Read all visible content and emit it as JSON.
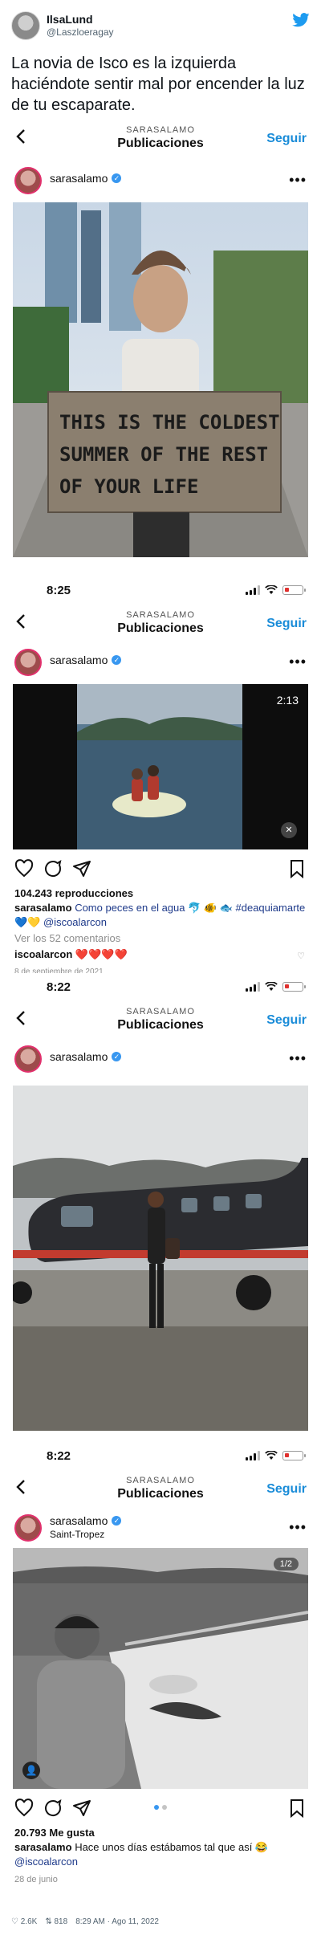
{
  "tweet": {
    "author_name": "IlsaLund",
    "author_handle": "@Laszloeragay",
    "text": "La novia de Isco es la izquierda haciéndote sentir mal por encender la luz de tu escaparate.",
    "likes": "2.6K",
    "retweets": "818",
    "timestamp": "8:29 AM · Ago 11, 2022"
  },
  "panels": [
    {
      "time": "",
      "nav_small": "SARASALAMO",
      "nav_title": "Publicaciones",
      "follow": "Seguir",
      "username": "sarasalamo",
      "location": "",
      "sign_lines": [
        "THIS IS THE COLDEST",
        "SUMMER OF THE REST",
        "OF YOUR LIFE"
      ]
    },
    {
      "time": "8:25",
      "nav_small": "SARASALAMO",
      "nav_title": "Publicaciones",
      "follow": "Seguir",
      "username": "sarasalamo",
      "video_time": "2:13",
      "views": "104.243 reproducciones",
      "caption_user": "sarasalamo",
      "caption": "Como peces en el agua 🐬 🐠 🐟 #deaquiamarte💙💛 @iscoalarcon",
      "comments": "Ver los 52 comentarios",
      "comment_user": "iscoalarcon",
      "comment_text": "❤️❤️❤️❤️",
      "date": "8 de septiembre de 2021"
    },
    {
      "time": "8:22",
      "nav_small": "SARASALAMO",
      "nav_title": "Publicaciones",
      "follow": "Seguir",
      "username": "sarasalamo"
    },
    {
      "time": "8:22",
      "nav_small": "SARASALAMO",
      "nav_title": "Publicaciones",
      "follow": "Seguir",
      "username": "sarasalamo",
      "location": "Saint-Tropez",
      "carousel": "1/2",
      "likes": "20.793 Me gusta",
      "caption_user": "sarasalamo",
      "caption": "Hace unos días estábamos tal que así 😂",
      "caption_tag": "@iscoalarcon",
      "date": "28 de junio"
    }
  ],
  "colors": {
    "follow_blue": "#1a8cd8",
    "verified_blue": "#3897f0",
    "battery_red": "#e0312f",
    "story_ring": "#e1306c"
  },
  "icons": [
    "twitter-bird-icon",
    "back-chevron-icon",
    "verified-icon",
    "more-icon",
    "heart-icon",
    "comment-icon",
    "share-icon",
    "bookmark-icon",
    "mute-icon",
    "user-tag-icon"
  ]
}
